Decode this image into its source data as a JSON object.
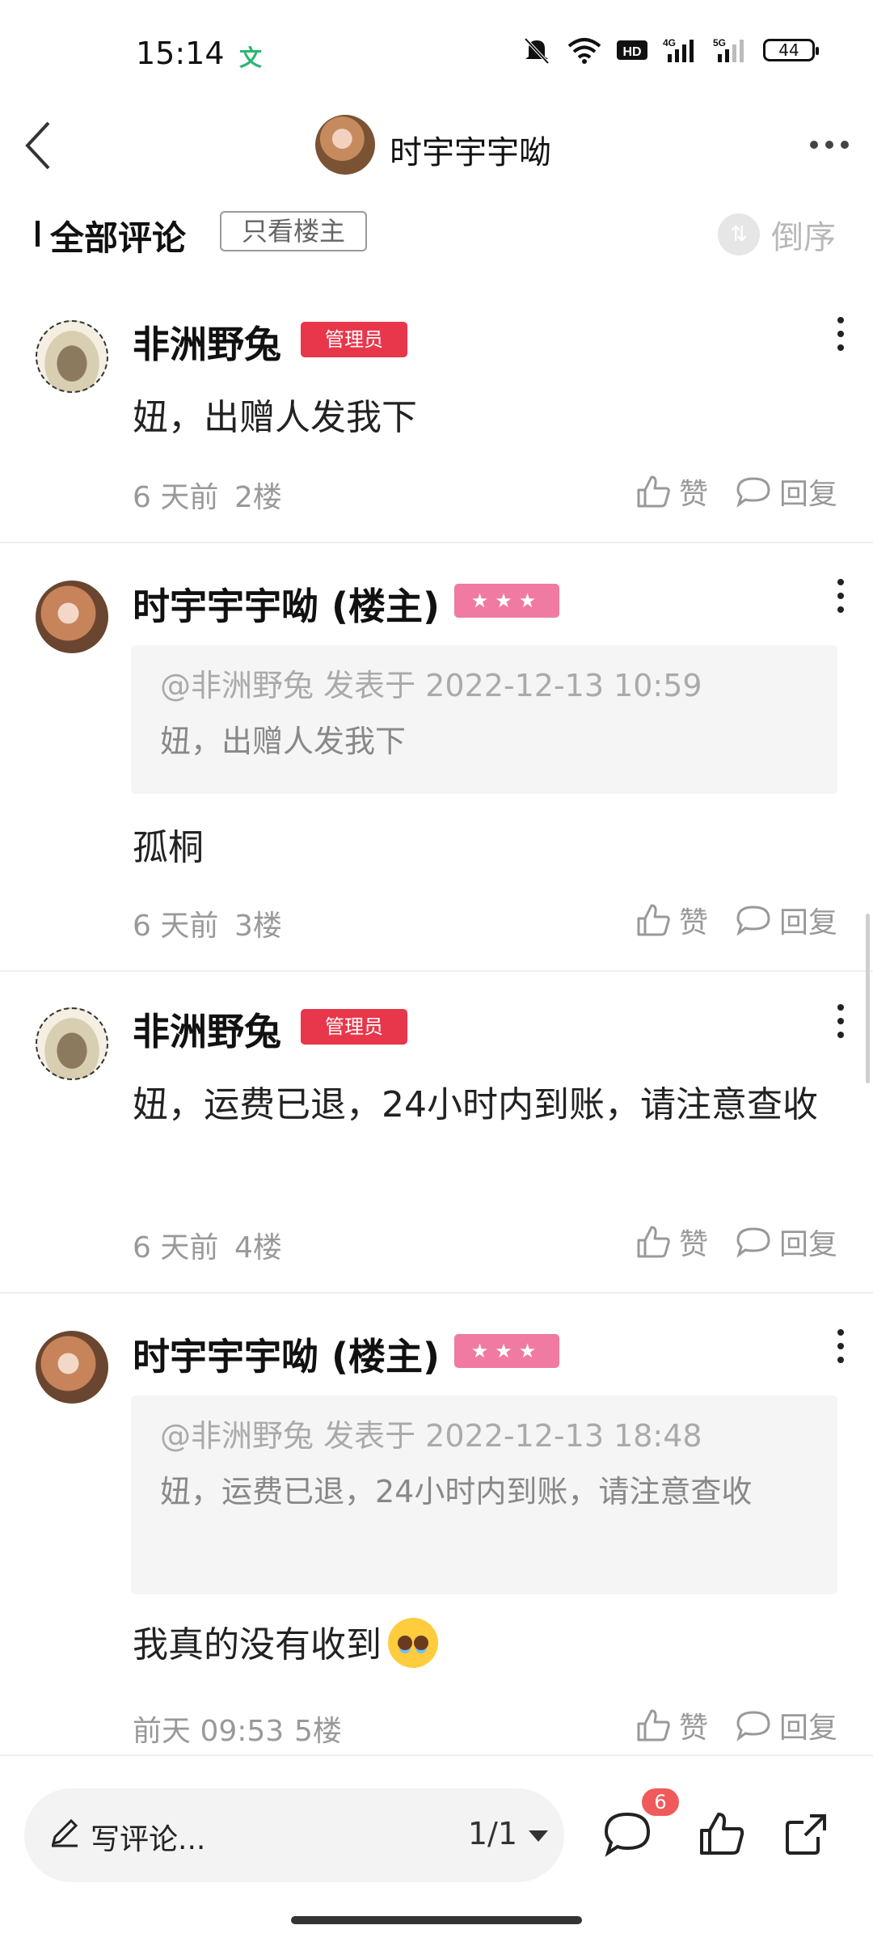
{
  "status": {
    "time": "15:14",
    "translate_glyph": "文",
    "battery": "44"
  },
  "nav": {
    "title": "时宇宇宇呦"
  },
  "filter": {
    "title": "全部评论",
    "only_op": "只看楼主",
    "sort": "倒序"
  },
  "comments": [
    {
      "name": "非洲野兔",
      "badge": "管理员",
      "text": "妞，出赠人发我下",
      "time": "6 天前",
      "floor": "2楼",
      "like": "赞",
      "reply": "回复"
    },
    {
      "name": "时宇宇宇呦 (楼主)",
      "badge": "★★★",
      "quote_head": "@非洲野兔 发表于 2022-12-13 10:59",
      "quote_body": "妞，出赠人发我下",
      "text": "孤桐",
      "time": "6 天前",
      "floor": "3楼",
      "like": "赞",
      "reply": "回复"
    },
    {
      "name": "非洲野兔",
      "badge": "管理员",
      "text": "妞，运费已退，24小时内到账，请注意查收",
      "time": "6 天前",
      "floor": "4楼",
      "like": "赞",
      "reply": "回复"
    },
    {
      "name": "时宇宇宇呦 (楼主)",
      "badge": "★★★",
      "quote_head": "@非洲野兔 发表于 2022-12-13 18:48",
      "quote_body": "妞，运费已退，24小时内到账，请注意查收",
      "text": "我真的没有收到",
      "time": "前天 09:53",
      "floor": "5楼",
      "like": "赞",
      "reply": "回复"
    }
  ],
  "bottom": {
    "compose_placeholder": "写评论...",
    "page_indicator": "1/1",
    "comment_count": "6"
  },
  "colors": {
    "admin_badge": "#e8364a",
    "star_badge": "#f07aa2",
    "notif_badge": "#f05a5a"
  }
}
